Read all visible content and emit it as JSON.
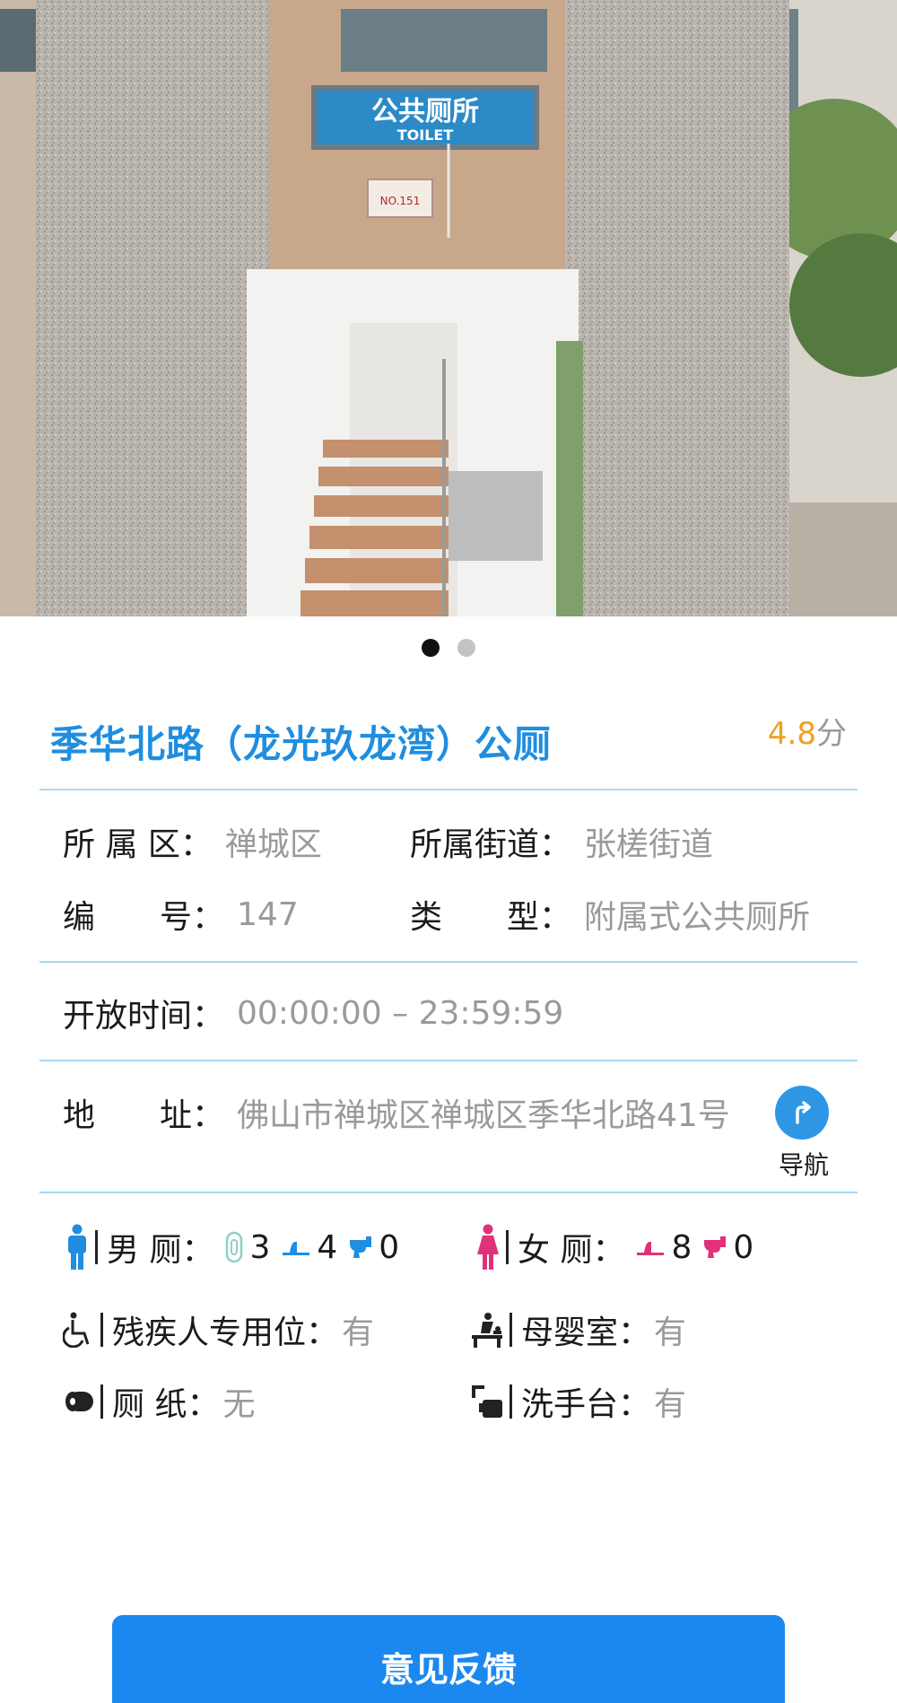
{
  "photo": {
    "sign_cn": "公共厕所",
    "sign_en": "TOILET",
    "plate": "NO.151"
  },
  "carousel": {
    "count": 2,
    "active": 0
  },
  "toilet": {
    "name": "季华北路（龙光玖龙湾）公厕",
    "rating_value": "4.8",
    "rating_unit": "分"
  },
  "info": {
    "district_label": "所 属 区：",
    "district_value": "禅城区",
    "street_label": "所属街道：",
    "street_value": "张槎街道",
    "number_label": "编　　号：",
    "number_value": "147",
    "type_label": "类　　型：",
    "type_value": "附属式公共厕所",
    "hours_label": "开放时间：",
    "hours_value": "00:00:00 – 23:59:59",
    "address_label": "地　　址：",
    "address_value": "佛山市禅城区禅城区季华北路41号",
    "nav_label": "导航"
  },
  "facilities": {
    "men_label": "男 厕：",
    "men_urinal": "3",
    "men_squat": "4",
    "men_seat": "0",
    "women_label": "女 厕：",
    "women_squat": "8",
    "women_seat": "0",
    "accessible_label": "残疾人专用位：",
    "accessible_value": "有",
    "baby_label": "母婴室：",
    "baby_value": "有",
    "paper_label": "厕 纸：",
    "paper_value": "无",
    "sink_label": "洗手台：",
    "sink_value": "有"
  },
  "feedback_label": "意见反馈",
  "colors": {
    "accent": "#1f8ee0",
    "rating": "#f0a020",
    "divider": "#a8d8f4",
    "men": "#1f8ee0",
    "women": "#e0317a",
    "button": "#1b88ef"
  }
}
